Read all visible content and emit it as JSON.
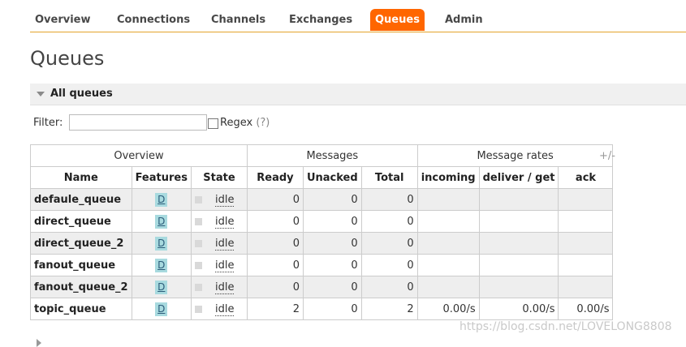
{
  "nav": {
    "tabs": [
      {
        "label": "Overview",
        "active": false
      },
      {
        "label": "Connections",
        "active": false
      },
      {
        "label": "Channels",
        "active": false
      },
      {
        "label": "Exchanges",
        "active": false
      },
      {
        "label": "Queues",
        "active": true
      },
      {
        "label": "Admin",
        "active": false
      }
    ]
  },
  "page": {
    "title": "Queues"
  },
  "section": {
    "title": "All queues"
  },
  "filter": {
    "label": "Filter:",
    "value": "",
    "regex_label": "Regex",
    "regex_help": "(?)",
    "regex_checked": false
  },
  "table": {
    "groups": [
      {
        "label": "Overview"
      },
      {
        "label": "Messages"
      },
      {
        "label": "Message rates"
      }
    ],
    "plus_minus": "+/-",
    "columns": [
      "Name",
      "Features",
      "State",
      "Ready",
      "Unacked",
      "Total",
      "incoming",
      "deliver / get",
      "ack"
    ],
    "rows": [
      {
        "name": "defaule_queue",
        "feature": "D",
        "state": "idle",
        "ready": "0",
        "unacked": "0",
        "total": "0",
        "incoming": "",
        "deliver_get": "",
        "ack": ""
      },
      {
        "name": "direct_queue",
        "feature": "D",
        "state": "idle",
        "ready": "0",
        "unacked": "0",
        "total": "0",
        "incoming": "",
        "deliver_get": "",
        "ack": ""
      },
      {
        "name": "direct_queue_2",
        "feature": "D",
        "state": "idle",
        "ready": "0",
        "unacked": "0",
        "total": "0",
        "incoming": "",
        "deliver_get": "",
        "ack": ""
      },
      {
        "name": "fanout_queue",
        "feature": "D",
        "state": "idle",
        "ready": "0",
        "unacked": "0",
        "total": "0",
        "incoming": "",
        "deliver_get": "",
        "ack": ""
      },
      {
        "name": "fanout_queue_2",
        "feature": "D",
        "state": "idle",
        "ready": "0",
        "unacked": "0",
        "total": "0",
        "incoming": "",
        "deliver_get": "",
        "ack": ""
      },
      {
        "name": "topic_queue",
        "feature": "D",
        "state": "idle",
        "ready": "2",
        "unacked": "0",
        "total": "2",
        "incoming": "0.00/s",
        "deliver_get": "0.00/s",
        "ack": "0.00/s"
      }
    ]
  },
  "watermark": "https://blog.csdn.net/LOVELONG8808",
  "colors": {
    "accent": "#ff6600",
    "nav_line": "#e3a32b",
    "badge": "#a8dadf"
  }
}
